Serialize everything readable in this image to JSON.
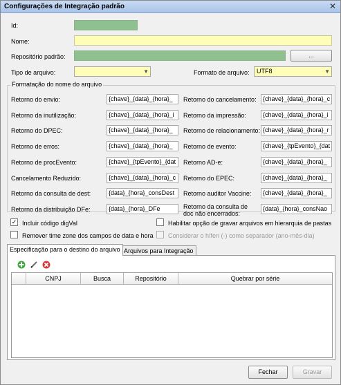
{
  "window": {
    "title": "Configurações de Integração padrão",
    "close_glyph": "✕"
  },
  "fields": {
    "id_label": "Id:",
    "id_value": "",
    "nome_label": "Nome:",
    "nome_value": "",
    "repo_label": "Repositório padrão:",
    "repo_value": "",
    "browse_label": "...",
    "tipo_label": "Tipo de arquivo:",
    "tipo_value": "",
    "formato_label": "Formato de arquivo:",
    "formato_value": "UTF8"
  },
  "format_group": {
    "title": "Formatação do nome do arquivo",
    "left": [
      {
        "label": "Retorno do envio:",
        "value": "{chave}_{data}_{hora}_"
      },
      {
        "label": "Retorno da inutilização:",
        "value": "{chave}_{data}_{hora}_i"
      },
      {
        "label": "Retorno do DPEC:",
        "value": "{chave}_{data}_{hora}_"
      },
      {
        "label": "Retorno de erros:",
        "value": "{chave}_{data}_{hora}_"
      },
      {
        "label": "Retorno de procEvento:",
        "value": "{chave}_{tpEvento}_{dat"
      },
      {
        "label": "Cancelamento Reduzido:",
        "value": "{chave}_{data}_{hora}_c"
      },
      {
        "label": "Retorno da consulta de dest:",
        "value": "{data}_{hora}_consDest"
      },
      {
        "label": "Retorno da distribuição DFe:",
        "value": "{data}_{hora}_DFe"
      }
    ],
    "right": [
      {
        "label": "Retorno do cancelamento:",
        "value": "{chave}_{data}_{hora}_c"
      },
      {
        "label": "Retorno da impressão:",
        "value": "{chave}_{data}_{hora}_i"
      },
      {
        "label": "Retorno de relacionamento:",
        "value": "{chave}_{data}_{hora}_r"
      },
      {
        "label": "Retorno de evento:",
        "value": "{chave}_{tpEvento}_{dat"
      },
      {
        "label": "Retorno AD-e:",
        "value": "{chave}_{data}_{hora}_"
      },
      {
        "label": "Retorno do EPEC:",
        "value": "{chave}_{data}_{hora}_"
      },
      {
        "label": "Retorno auditor Vaccine:",
        "value": "{chave}_{data}_{hora}_"
      },
      {
        "label": "Retorno da consulta de doc não encerrados:",
        "value": "{data}_{hora}_consNao"
      }
    ]
  },
  "options": {
    "incluir_digval": {
      "label": "Incluir código digVal",
      "checked": true
    },
    "hierarquia": {
      "label": "Habilitar opção de gravar arquivos em hierarquia de pastas",
      "checked": false
    },
    "remover_tz": {
      "label": "Remover time zone dos campos de data e hora",
      "checked": false
    },
    "hifen": {
      "label": "Considerar o hífen (-) como separador (ano-mês-dia)",
      "checked": false
    }
  },
  "tabs": [
    {
      "label": "Especificação para o destino do arquivo",
      "active": true
    },
    {
      "label": "Arquivos para Integração",
      "active": false
    }
  ],
  "toolbar": {
    "add": "add-icon",
    "edit": "edit-icon",
    "delete": "delete-icon"
  },
  "table": {
    "columns": [
      "CNPJ",
      "Busca",
      "Repositório",
      "Quebrar por série"
    ],
    "rows": []
  },
  "footer": {
    "fechar": "Fechar",
    "gravar": "Gravar"
  },
  "colors": {
    "required_green": "#8fc08f",
    "required_yellow": "#fffeb8"
  }
}
